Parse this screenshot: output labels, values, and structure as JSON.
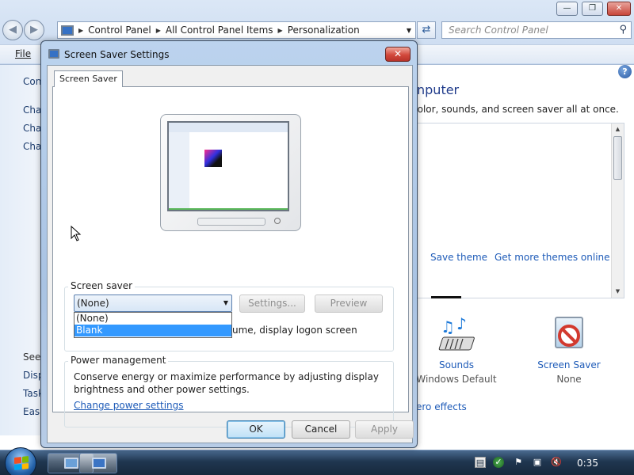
{
  "explorer": {
    "breadcrumbs": [
      "Control Panel",
      "All Control Panel Items",
      "Personalization"
    ],
    "search_placeholder": "Search Control Panel",
    "menu_file": "File",
    "left_pane": [
      "Con",
      "Cha",
      "Cha",
      "Cha",
      "See",
      "Disp",
      "Task",
      "Ease"
    ],
    "heading_fragment": "nputer",
    "subtitle_fragment": "color, sounds, and screen saver all at once.",
    "save_theme": "Save theme",
    "get_more_themes": "Get more themes online",
    "sounds_label": "Sounds",
    "sounds_value": "Windows Default",
    "screensaver_label": "Screen Saver",
    "screensaver_value": "None",
    "aero_fragment": "ero effects"
  },
  "dialog": {
    "title": "Screen Saver Settings",
    "tab": "Screen Saver",
    "screensaver_group": "Screen saver",
    "selected_value": "(None)",
    "options": [
      "(None)",
      "Blank"
    ],
    "highlighted_option": "Blank",
    "settings_button": "Settings...",
    "preview_button": "Preview",
    "logon_text_fragment": "ume, display logon screen",
    "power_group": "Power management",
    "power_desc": "Conserve energy or maximize performance by adjusting display brightness and other power settings.",
    "power_link": "Change power settings",
    "ok": "OK",
    "cancel": "Cancel",
    "apply": "Apply"
  },
  "taskbar": {
    "clock": "0:35"
  },
  "colors": {
    "dialog_frame": "#a9c3e3",
    "link": "#1e5bb8",
    "selection": "#3399ff",
    "close_red": "#d2493c"
  }
}
